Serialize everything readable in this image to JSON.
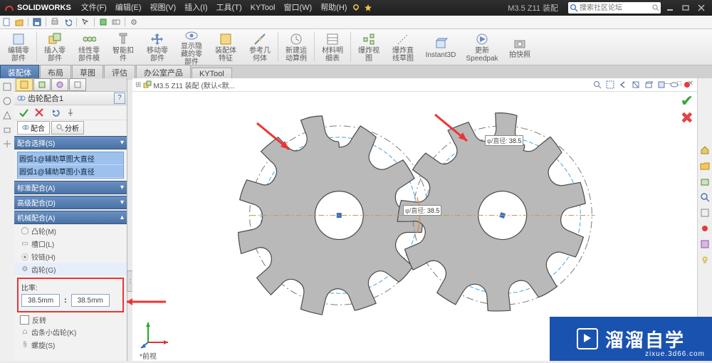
{
  "app": {
    "brand": "SOLIDWORKS"
  },
  "menus": [
    "文件(F)",
    "编辑(E)",
    "视图(V)",
    "插入(I)",
    "工具(T)",
    "KYTool",
    "窗口(W)",
    "帮助(H)"
  ],
  "doc_name": "M3.5 Z11 装配",
  "search_placeholder": "搜索社区论坛",
  "ribbon": [
    {
      "id": "edit-part",
      "label": "编辑零\n部件"
    },
    {
      "id": "insert-part",
      "label": "插入零\n部件"
    },
    {
      "id": "linear-pat",
      "label": "线性零\n部件模"
    },
    {
      "id": "smart-fas",
      "label": "智能扣\n件"
    },
    {
      "id": "move-part",
      "label": "移动零\n部件"
    },
    {
      "id": "show-hide",
      "label": "显示隐\n藏的零\n部件"
    },
    {
      "id": "asm-feat",
      "label": "装配体\n特征"
    },
    {
      "id": "ref-geom",
      "label": "参考几\n何体"
    },
    {
      "id": "motion",
      "label": "新建运\n动算例"
    },
    {
      "id": "bom",
      "label": "材料明\n细表"
    },
    {
      "id": "explode",
      "label": "爆炸视\n图"
    },
    {
      "id": "explode-line",
      "label": "爆炸直\n线草图"
    },
    {
      "id": "instant3d",
      "label": "Instant3D"
    },
    {
      "id": "speedpak",
      "label": "更新\nSpeedpak"
    },
    {
      "id": "snapshot",
      "label": "拍快照"
    }
  ],
  "rib_tabs": [
    "装配体",
    "布局",
    "草图",
    "评估",
    "办公室产品",
    "KYTool"
  ],
  "panel": {
    "title": "齿轮配合1",
    "sub_tabs": {
      "mate": "配合",
      "analysis": "分析"
    },
    "group_sel": "配合选择(S)",
    "sel_rows": [
      "圆弧1@辅助草图大直径",
      "圆弧1@辅助草图小直径"
    ],
    "group_std": "标准配合(A)",
    "group_adv": "高级配合(D)",
    "group_mech": "机械配合(A)",
    "opts": [
      {
        "id": "cam",
        "label": "凸轮(M)"
      },
      {
        "id": "slot",
        "label": "槽口(L)"
      },
      {
        "id": "hinge",
        "label": "铰链(H)"
      },
      {
        "id": "gear",
        "label": "齿轮(G)",
        "sel": true
      }
    ],
    "ratio_label": "比率:",
    "ratio_a": "38.5mm",
    "ratio_b": "38.5mm",
    "reverse": "反转",
    "rack": "齿条小齿轮(K)",
    "screw": "螺旋(S)"
  },
  "breadcrumb": "M3.5 Z11 装配 (默认<默...",
  "dim": {
    "label": "φ/直径:",
    "value1": "38.5",
    "value2": "38.5"
  },
  "view_name": "*前视",
  "watermark": {
    "big": "溜溜自学",
    "small": "zixue.3d66.com"
  },
  "chart_data": {
    "type": "diagram",
    "description": "Two identical spur gears in mesh, each 10 teeth, pitch/reference diameter 38.5 mm, displayed in SolidWorks assembly mate dialog (gear mate, ratio 38.5 : 38.5).",
    "gears": [
      {
        "teeth": 10,
        "pitch_diameter_mm": 38.5
      },
      {
        "teeth": 10,
        "pitch_diameter_mm": 38.5
      }
    ],
    "mate_ratio": [
      38.5,
      38.5
    ]
  }
}
